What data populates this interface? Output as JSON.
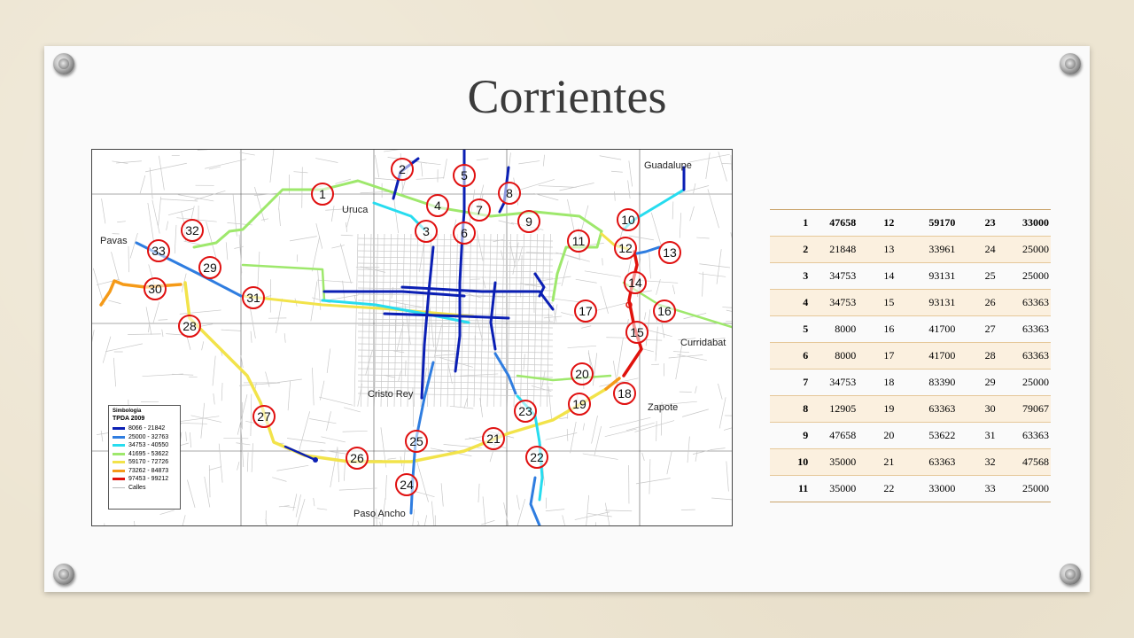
{
  "slide": {
    "title": "Corrientes"
  },
  "map": {
    "places": [
      "Guadalupe",
      "Uruca",
      "Pavas",
      "Curridabat",
      "Cristo Rey",
      "Zapote",
      "Paso Ancho"
    ],
    "legend": {
      "heading": "Simbologia",
      "subtitle": "TPDA 2009",
      "entries": [
        {
          "label": "8066 - 21842",
          "color": "#0b1fb4"
        },
        {
          "label": "25000 - 32763",
          "color": "#2f7de0"
        },
        {
          "label": "34753 - 40550",
          "color": "#27dcef"
        },
        {
          "label": "41695 - 53622",
          "color": "#9ee86c"
        },
        {
          "label": "59170 - 72726",
          "color": "#f2e34a"
        },
        {
          "label": "73262 - 84873",
          "color": "#f59a18"
        },
        {
          "label": "97453 - 99212",
          "color": "#e0120c"
        },
        {
          "label": "Calles",
          "color": "#bbbbbb"
        }
      ]
    },
    "markers": [
      "1",
      "2",
      "3",
      "4",
      "5",
      "6",
      "7",
      "8",
      "9",
      "10",
      "11",
      "12",
      "13",
      "14",
      "15",
      "16",
      "17",
      "18",
      "19",
      "20",
      "21",
      "22",
      "23",
      "24",
      "25",
      "26",
      "27",
      "28",
      "29",
      "30",
      "31",
      "32",
      "33"
    ]
  },
  "table": {
    "rows": [
      [
        "1",
        "47658",
        "12",
        "59170",
        "23",
        "33000"
      ],
      [
        "2",
        "21848",
        "13",
        "33961",
        "24",
        "25000"
      ],
      [
        "3",
        "34753",
        "14",
        "93131",
        "25",
        "25000"
      ],
      [
        "4",
        "34753",
        "15",
        "93131",
        "26",
        "63363"
      ],
      [
        "5",
        "8000",
        "16",
        "41700",
        "27",
        "63363"
      ],
      [
        "6",
        "8000",
        "17",
        "41700",
        "28",
        "63363"
      ],
      [
        "7",
        "34753",
        "18",
        "83390",
        "29",
        "25000"
      ],
      [
        "8",
        "12905",
        "19",
        "63363",
        "30",
        "79067"
      ],
      [
        "9",
        "47658",
        "20",
        "53622",
        "31",
        "63363"
      ],
      [
        "10",
        "35000",
        "21",
        "63363",
        "32",
        "47568"
      ],
      [
        "11",
        "35000",
        "22",
        "33000",
        "33",
        "25000"
      ]
    ]
  }
}
